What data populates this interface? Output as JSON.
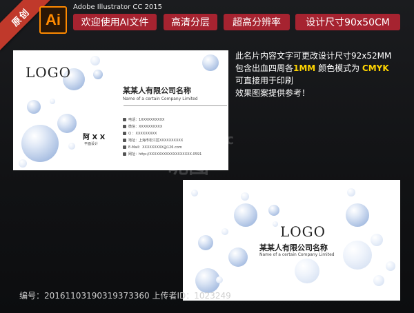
{
  "ribbon": "原创",
  "app": {
    "logo_text": "Ai",
    "name": "Adobe Illustrator CC 2015"
  },
  "tags": [
    "欢迎使用AI文件",
    "高清分层",
    "超高分辨率",
    "设计尺寸90x50CM"
  ],
  "description": {
    "line1": "此名片内容文字可更改设计尺寸92x52MM",
    "line2_a": "包含出血四周各",
    "line2_hl1": "1MM",
    "line2_b": "  颜色模式为 ",
    "line2_hl2": "CMYK",
    "line3": "可直接用于印刷",
    "line4": "效果图案提供参考！"
  },
  "front_card": {
    "logo": "LOGO",
    "company_cn": "某某人有限公司名称",
    "company_en": "Name of a certain Company Limited",
    "person": "阿 X X",
    "title": "平面设计",
    "contacts": [
      "电话：1XXXXXXXXXX",
      "微信：XXXXXXXXXX",
      "Q    ：XXXXXXXXX",
      "地址：上海市松江区XXXXXXXXXX",
      "E-Mail：XXXXXXXXX@126.com",
      "网址：http://XXXXXXXXXXXXXXXXXX.0591"
    ]
  },
  "back_card": {
    "logo": "LOGO",
    "company_cn": "某某人有限公司名称",
    "company_en": "Name of a certain Company Limited"
  },
  "footer": "编号：20161103190319373360 上传者ID：1023249",
  "colors": {
    "tag_bg": "#a62330",
    "ribbon": "#c0392b",
    "ai_orange": "#ff8a00",
    "highlight": "#ffd400"
  }
}
